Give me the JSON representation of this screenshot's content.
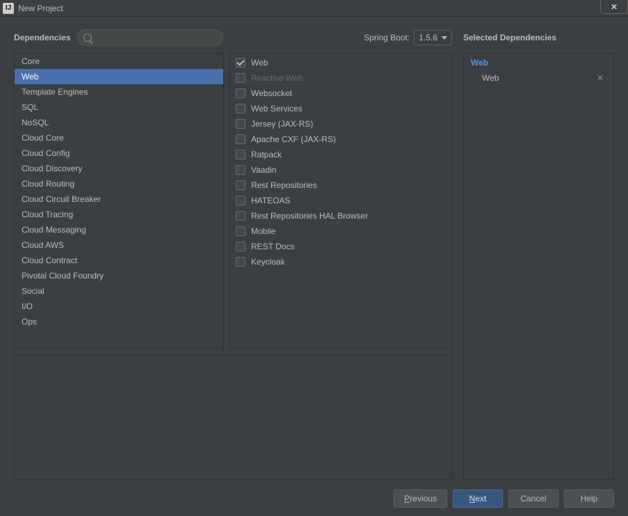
{
  "window": {
    "title": "New Project"
  },
  "header": {
    "dependencies_label": "Dependencies",
    "spring_boot_label": "Spring Boot:",
    "spring_boot_version": "1.5.6",
    "search_placeholder": ""
  },
  "categories": [
    {
      "label": "Core",
      "selected": false
    },
    {
      "label": "Web",
      "selected": true
    },
    {
      "label": "Template Engines",
      "selected": false
    },
    {
      "label": "SQL",
      "selected": false
    },
    {
      "label": "NoSQL",
      "selected": false
    },
    {
      "label": "Cloud Core",
      "selected": false
    },
    {
      "label": "Cloud Config",
      "selected": false
    },
    {
      "label": "Cloud Discovery",
      "selected": false
    },
    {
      "label": "Cloud Routing",
      "selected": false
    },
    {
      "label": "Cloud Circuit Breaker",
      "selected": false
    },
    {
      "label": "Cloud Tracing",
      "selected": false
    },
    {
      "label": "Cloud Messaging",
      "selected": false
    },
    {
      "label": "Cloud AWS",
      "selected": false
    },
    {
      "label": "Cloud Contract",
      "selected": false
    },
    {
      "label": "Pivotal Cloud Foundry",
      "selected": false
    },
    {
      "label": "Social",
      "selected": false
    },
    {
      "label": "I/O",
      "selected": false
    },
    {
      "label": "Ops",
      "selected": false
    }
  ],
  "options": [
    {
      "label": "Web",
      "checked": true,
      "disabled": false
    },
    {
      "label": "Reactive Web",
      "checked": false,
      "disabled": true
    },
    {
      "label": "Websocket",
      "checked": false,
      "disabled": false
    },
    {
      "label": "Web Services",
      "checked": false,
      "disabled": false
    },
    {
      "label": "Jersey (JAX-RS)",
      "checked": false,
      "disabled": false
    },
    {
      "label": "Apache CXF (JAX-RS)",
      "checked": false,
      "disabled": false
    },
    {
      "label": "Ratpack",
      "checked": false,
      "disabled": false
    },
    {
      "label": "Vaadin",
      "checked": false,
      "disabled": false
    },
    {
      "label": "Rest Repositories",
      "checked": false,
      "disabled": false
    },
    {
      "label": "HATEOAS",
      "checked": false,
      "disabled": false
    },
    {
      "label": "Rest Repositories HAL Browser",
      "checked": false,
      "disabled": false
    },
    {
      "label": "Mobile",
      "checked": false,
      "disabled": false
    },
    {
      "label": "REST Docs",
      "checked": false,
      "disabled": false
    },
    {
      "label": "Keycloak",
      "checked": false,
      "disabled": false
    }
  ],
  "selected_panel": {
    "title": "Selected Dependencies",
    "groups": [
      {
        "name": "Web",
        "items": [
          "Web"
        ]
      }
    ]
  },
  "buttons": {
    "previous": "Previous",
    "next": "Next",
    "cancel": "Cancel",
    "help": "Help"
  }
}
